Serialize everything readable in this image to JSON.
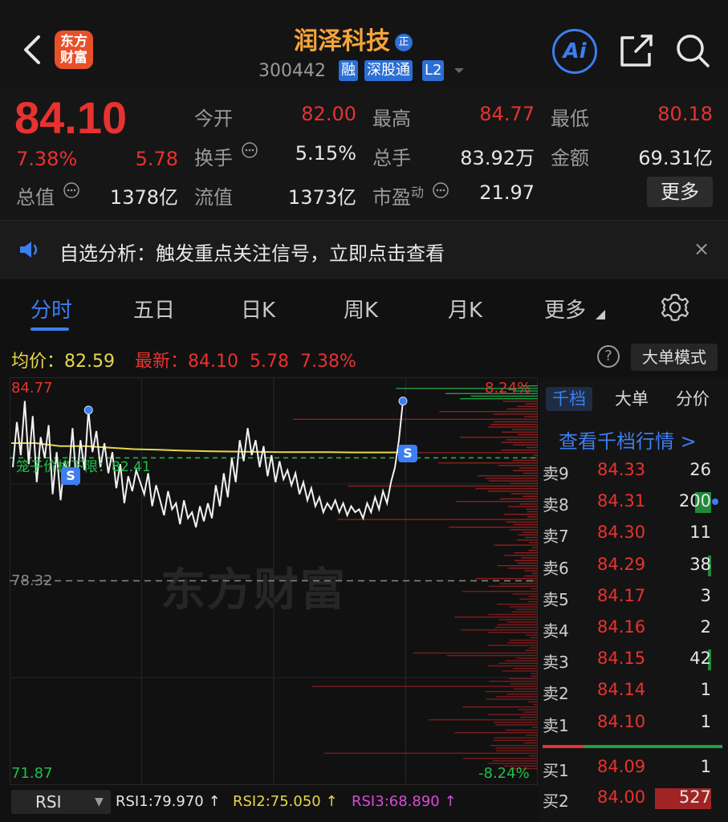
{
  "header": {
    "logo_line1": "东方",
    "logo_line2": "财富",
    "title": "润泽科技",
    "title_badge": "正",
    "code": "300442",
    "tags": [
      "融",
      "深股通",
      "L2"
    ],
    "ai_label": "Ai"
  },
  "quote": {
    "price": "84.10",
    "change_pct": "7.38%",
    "change_amt": "5.78",
    "total_mkt_label": "总值",
    "total_mkt_value": "1378亿",
    "open_label": "今开",
    "open_value": "82.00",
    "turnover_label": "换手",
    "turnover_value": "5.15%",
    "float_mkt_label": "流值",
    "float_mkt_value": "1373亿",
    "high_label": "最高",
    "high_value": "84.77",
    "volume_label": "总手",
    "volume_value": "83.92万",
    "pe_label": "市盈",
    "pe_sup": "动",
    "pe_value": "21.97",
    "low_label": "最低",
    "low_value": "80.18",
    "amount_label": "金额",
    "amount_value": "69.31亿",
    "more_label": "更多"
  },
  "alert": {
    "text": "自选分析：触发重点关注信号，立即点击查看",
    "close": "×"
  },
  "tabs": [
    "分时",
    "五日",
    "日K",
    "周K",
    "月K",
    "更多"
  ],
  "active_tab": 0,
  "info": {
    "avg_label": "均价：",
    "avg_value": "82.59",
    "latest_label": "最新：",
    "latest_price": "84.10",
    "latest_change": "5.78",
    "latest_pct": "7.38%",
    "help": "?",
    "big_mode": "大单模式"
  },
  "chart_axes": {
    "top_left": "84.77",
    "mid_left": "78.32",
    "bottom_left": "71.87",
    "top_right": "8.24%",
    "bottom_right": "-8.24%",
    "limit_label": "笼子价格下限：82.41",
    "watermark": "东方财富",
    "signal": "S"
  },
  "colors": {
    "up": "#e8322f",
    "down": "#1e9f45",
    "accent": "#3d7ef0",
    "title": "#f4a43b",
    "avg_line": "#e6d84a"
  },
  "chart_data": {
    "type": "line",
    "ylim": [
      71.87,
      84.77
    ],
    "reference": 78.32,
    "avg_price": 82.59,
    "limit_line": 82.41,
    "x_range": [
      0,
      240
    ],
    "series": [
      {
        "values": [
          82.1,
          83.6,
          82.5,
          84.3,
          82.2,
          83.8,
          81.6,
          83.1,
          82.4,
          83.5,
          81.2,
          82.6,
          81.0,
          82.3,
          81.8,
          83.4,
          81.5,
          83.0,
          82.0,
          84.0,
          82.6,
          83.3,
          82.1,
          82.9,
          81.9,
          82.6,
          81.4,
          82.2,
          80.9,
          81.8,
          81.3,
          82.0,
          81.6,
          81.2,
          81.9,
          80.8,
          81.5,
          81.0,
          80.5,
          81.3,
          80.7,
          80.9,
          80.2,
          81.0,
          80.4,
          80.6,
          80.1,
          80.8,
          80.3,
          80.9,
          80.4,
          81.5,
          80.8,
          81.9,
          81.1,
          82.4,
          81.6,
          83.0,
          82.3,
          83.4,
          82.5,
          83.0,
          82.1,
          82.8,
          81.8,
          82.5,
          81.6,
          82.3,
          81.7,
          82.0,
          81.5,
          81.9,
          81.2,
          81.6,
          81.0,
          81.4,
          80.8,
          81.1,
          80.6,
          80.9,
          80.7,
          81.0,
          80.6,
          80.9,
          80.5,
          80.8,
          80.6,
          80.7,
          80.4,
          80.9,
          80.6,
          81.1,
          80.7,
          81.3,
          80.9,
          81.6,
          82.1,
          83.0,
          84.3
        ]
      },
      {
        "values": [
          82.9,
          82.9,
          82.8,
          82.8,
          82.75,
          82.7,
          82.68,
          82.65,
          82.63,
          82.62,
          82.61,
          82.6,
          82.6,
          82.6,
          82.59,
          82.59,
          82.59
        ]
      }
    ]
  },
  "order_book": {
    "tabs": [
      "千档",
      "大单",
      "分价"
    ],
    "link": "查看千档行情 >",
    "asks": [
      {
        "label": "卖9",
        "price": "84.33",
        "vol": "26",
        "bar": 0
      },
      {
        "label": "卖8",
        "price": "84.31",
        "vol": "200",
        "bar": 0.2
      },
      {
        "label": "卖7",
        "price": "84.30",
        "vol": "11",
        "bar": 0
      },
      {
        "label": "卖6",
        "price": "84.29",
        "vol": "38",
        "bar": 0.04
      },
      {
        "label": "卖5",
        "price": "84.17",
        "vol": "3",
        "bar": 0
      },
      {
        "label": "卖4",
        "price": "84.16",
        "vol": "2",
        "bar": 0
      },
      {
        "label": "卖3",
        "price": "84.15",
        "vol": "42",
        "bar": 0.04
      },
      {
        "label": "卖2",
        "price": "84.14",
        "vol": "1",
        "bar": 0
      },
      {
        "label": "卖1",
        "price": "84.10",
        "vol": "1",
        "bar": 0
      }
    ],
    "bids": [
      {
        "label": "买1",
        "price": "84.09",
        "vol": "1",
        "bar": 0
      },
      {
        "label": "买2",
        "price": "84.00",
        "vol": "527",
        "bar": 0.7
      }
    ]
  },
  "indicator": {
    "name": "RSI",
    "rsi1": "RSI1:79.970 ↑",
    "rsi2": "RSI2:75.050 ↑",
    "rsi3": "RSI3:68.890 ↑",
    "rsi1_color": "#e6e6e6",
    "rsi2_color": "#e6d84a",
    "rsi3_color": "#d94bd9"
  }
}
